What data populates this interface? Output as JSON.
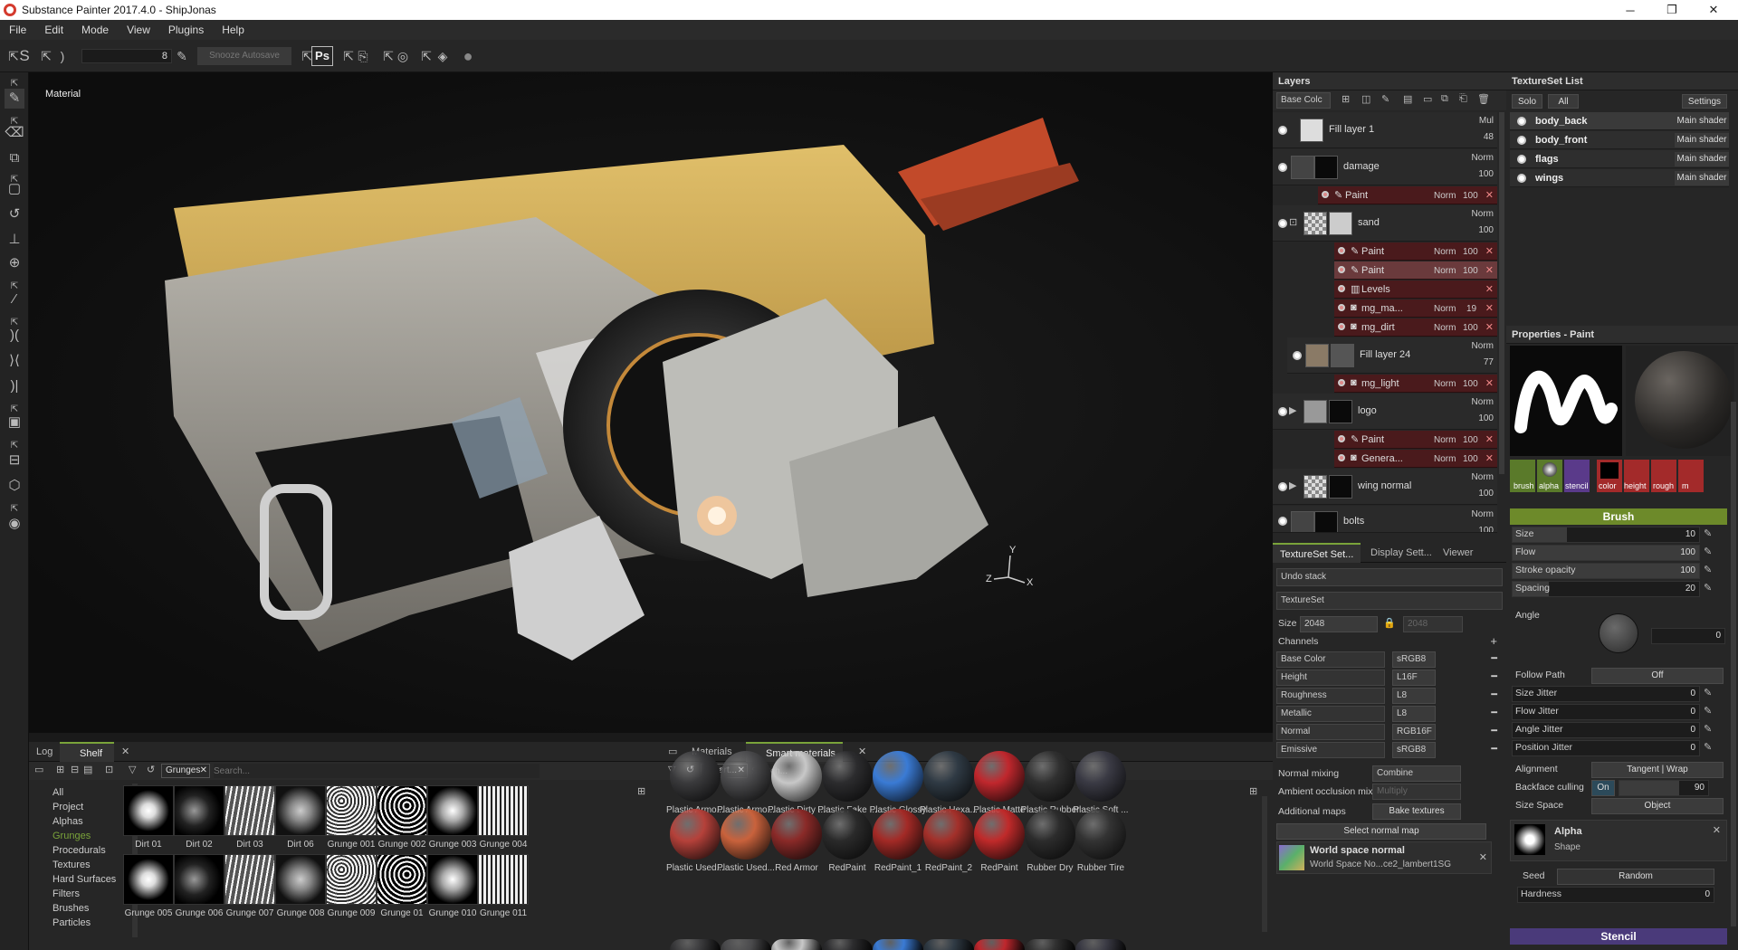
{
  "app": {
    "title": "Substance Painter 2017.4.0 - ShipJonas",
    "minimize": "─",
    "maximize": "❐",
    "close": "✕"
  },
  "menu": [
    "File",
    "Edit",
    "Mode",
    "View",
    "Plugins",
    "Help"
  ],
  "toolbar": {
    "brush_value": "8",
    "snooze": "Snooze Autosave",
    "ps": "Ps"
  },
  "viewport": {
    "mode_label": "Material",
    "axis_x": "X",
    "axis_y": "Y",
    "axis_z": "Z"
  },
  "layers": {
    "title": "Layers",
    "channel_dropdown": "Base Colc",
    "rows": [
      {
        "name": "Fill layer 1",
        "blend": "Mul",
        "opacity": "48"
      },
      {
        "name": "damage",
        "blend": "Norm",
        "opacity": "100"
      },
      {
        "name": "sand",
        "blend": "Norm",
        "opacity": "100"
      },
      {
        "name": "Fill layer 24",
        "blend": "Norm",
        "opacity": "77"
      },
      {
        "name": "logo",
        "blend": "Norm",
        "opacity": "100"
      },
      {
        "name": "wing normal",
        "blend": "Norm",
        "opacity": "100"
      },
      {
        "name": "bolts",
        "blend": "Norm",
        "opacity": "100"
      }
    ],
    "subs": [
      {
        "name": "Paint",
        "blend": "Norm",
        "opacity": "100"
      },
      {
        "name": "Paint",
        "blend": "Norm",
        "opacity": "100"
      },
      {
        "name": "Paint",
        "blend": "Norm",
        "opacity": "100"
      },
      {
        "name": "Levels",
        "blend": "",
        "opacity": ""
      },
      {
        "name": "mg_ma...",
        "blend": "Norm",
        "opacity": "19"
      },
      {
        "name": "mg_dirt",
        "blend": "Norm",
        "opacity": "100"
      },
      {
        "name": "mg_light",
        "blend": "Norm",
        "opacity": "100"
      },
      {
        "name": "Paint",
        "blend": "Norm",
        "opacity": "100"
      },
      {
        "name": "Genera...",
        "blend": "Norm",
        "opacity": "100"
      }
    ]
  },
  "textureset_list": {
    "title": "TextureSet List",
    "solo": "Solo",
    "all": "All",
    "settings": "Settings",
    "items": [
      {
        "name": "body_back",
        "shader": "Main shader"
      },
      {
        "name": "body_front",
        "shader": "Main shader"
      },
      {
        "name": "flags",
        "shader": "Main shader"
      },
      {
        "name": "wings",
        "shader": "Main shader"
      }
    ]
  },
  "properties": {
    "title": "Properties - Paint",
    "slots": [
      "brush",
      "alpha",
      "stencil",
      "color",
      "height",
      "rough",
      "m"
    ],
    "brush_header": "Brush",
    "size": {
      "label": "Size",
      "value": "10"
    },
    "flow": {
      "label": "Flow",
      "value": "100"
    },
    "stroke_opacity": {
      "label": "Stroke opacity",
      "value": "100"
    },
    "spacing": {
      "label": "Spacing",
      "value": "20"
    },
    "angle": {
      "label": "Angle",
      "value": "0"
    },
    "follow_path": {
      "label": "Follow Path",
      "value": "Off"
    },
    "size_jitter": {
      "label": "Size Jitter",
      "value": "0"
    },
    "flow_jitter": {
      "label": "Flow Jitter",
      "value": "0"
    },
    "angle_jitter": {
      "label": "Angle Jitter",
      "value": "0"
    },
    "position_jitter": {
      "label": "Position Jitter",
      "value": "0"
    },
    "alignment": {
      "label": "Alignment",
      "value": "Tangent | Wrap"
    },
    "backface": {
      "label": "Backface culling",
      "toggle": "On",
      "value": "90"
    },
    "size_space": {
      "label": "Size Space",
      "value": "Object"
    },
    "alpha_title": "Alpha",
    "alpha_shape": "Shape",
    "seed": {
      "label": "Seed",
      "value": "Random"
    },
    "hardness": {
      "label": "Hardness",
      "value": "0"
    },
    "stencil_header": "Stencil"
  },
  "tsettings": {
    "tabs": [
      "TextureSet Set...",
      "Display Sett...",
      "Viewer Sett..."
    ],
    "undo": "Undo stack",
    "textureset": "TextureSet",
    "size_label": "Size",
    "size_value": "2048",
    "size_value2": "2048",
    "channels": "Channels",
    "channel_rows": [
      {
        "name": "Base Color",
        "format": "sRGB8"
      },
      {
        "name": "Height",
        "format": "L16F"
      },
      {
        "name": "Roughness",
        "format": "L8"
      },
      {
        "name": "Metallic",
        "format": "L8"
      },
      {
        "name": "Normal",
        "format": "RGB16F"
      },
      {
        "name": "Emissive",
        "format": "sRGB8"
      }
    ],
    "normal_mixing": "Normal mixing",
    "normal_mixing_value": "Combine",
    "ao_mixing": "Ambient occlusion mixing",
    "ao_mixing_value": "Multiply",
    "additional_maps": "Additional maps",
    "bake": "Bake textures",
    "select_normal": "Select normal map",
    "ws_title": "World space normal",
    "ws_sub": "World Space No...ce2_lambert1SG"
  },
  "shelf": {
    "tabs": [
      "Log",
      "Shelf"
    ],
    "filter": "Grunges",
    "search_placeholder": "Search...",
    "categories": [
      "All",
      "Project",
      "Alphas",
      "Grunges",
      "Procedurals",
      "Textures",
      "Hard Surfaces",
      "Filters",
      "Brushes",
      "Particles"
    ],
    "items": [
      "Dirt 01",
      "Dirt 02",
      "Dirt 03",
      "Dirt 06",
      "Grunge 001",
      "Grunge 002",
      "Grunge 003",
      "Grunge 004",
      "Grunge 005",
      "Grunge 006",
      "Grunge 007",
      "Grunge 008",
      "Grunge 009",
      "Grunge 01",
      "Grunge 010",
      "Grunge 011"
    ]
  },
  "smart": {
    "tabs": [
      "Materials",
      "Smart materials"
    ],
    "filter": "Smart...",
    "search_placeholder": "Search...",
    "row1": [
      "Plastic Armo...",
      "Plastic Armo...",
      "Plastic Dirty ...",
      "Plastic Fake ...",
      "Plastic Glossy",
      "Plastic Hexa...",
      "Plastic Matte",
      "Plastic Rubber",
      "Plastic Soft ..."
    ],
    "row2": [
      "Plastic Used...",
      "Plastic Used...",
      "Red Armor",
      "RedPaint",
      "RedPaint_1",
      "RedPaint_2",
      "RedPaint",
      "Rubber Dry",
      "Rubber Tire"
    ],
    "row1_colors": [
      "#3a3a3c",
      "#4a4a4c",
      "#c8c8c8",
      "#2c2c2e",
      "#3a7bd5",
      "#2f3a44",
      "#c0272d",
      "#303030",
      "#3a3a44"
    ],
    "row2_colors": [
      "#b5413a",
      "#c9623c",
      "#8a2a28",
      "#2a2a2a",
      "#a32a26",
      "#a3302a",
      "#c02a2a",
      "#2c2c2c",
      "#333333"
    ]
  }
}
